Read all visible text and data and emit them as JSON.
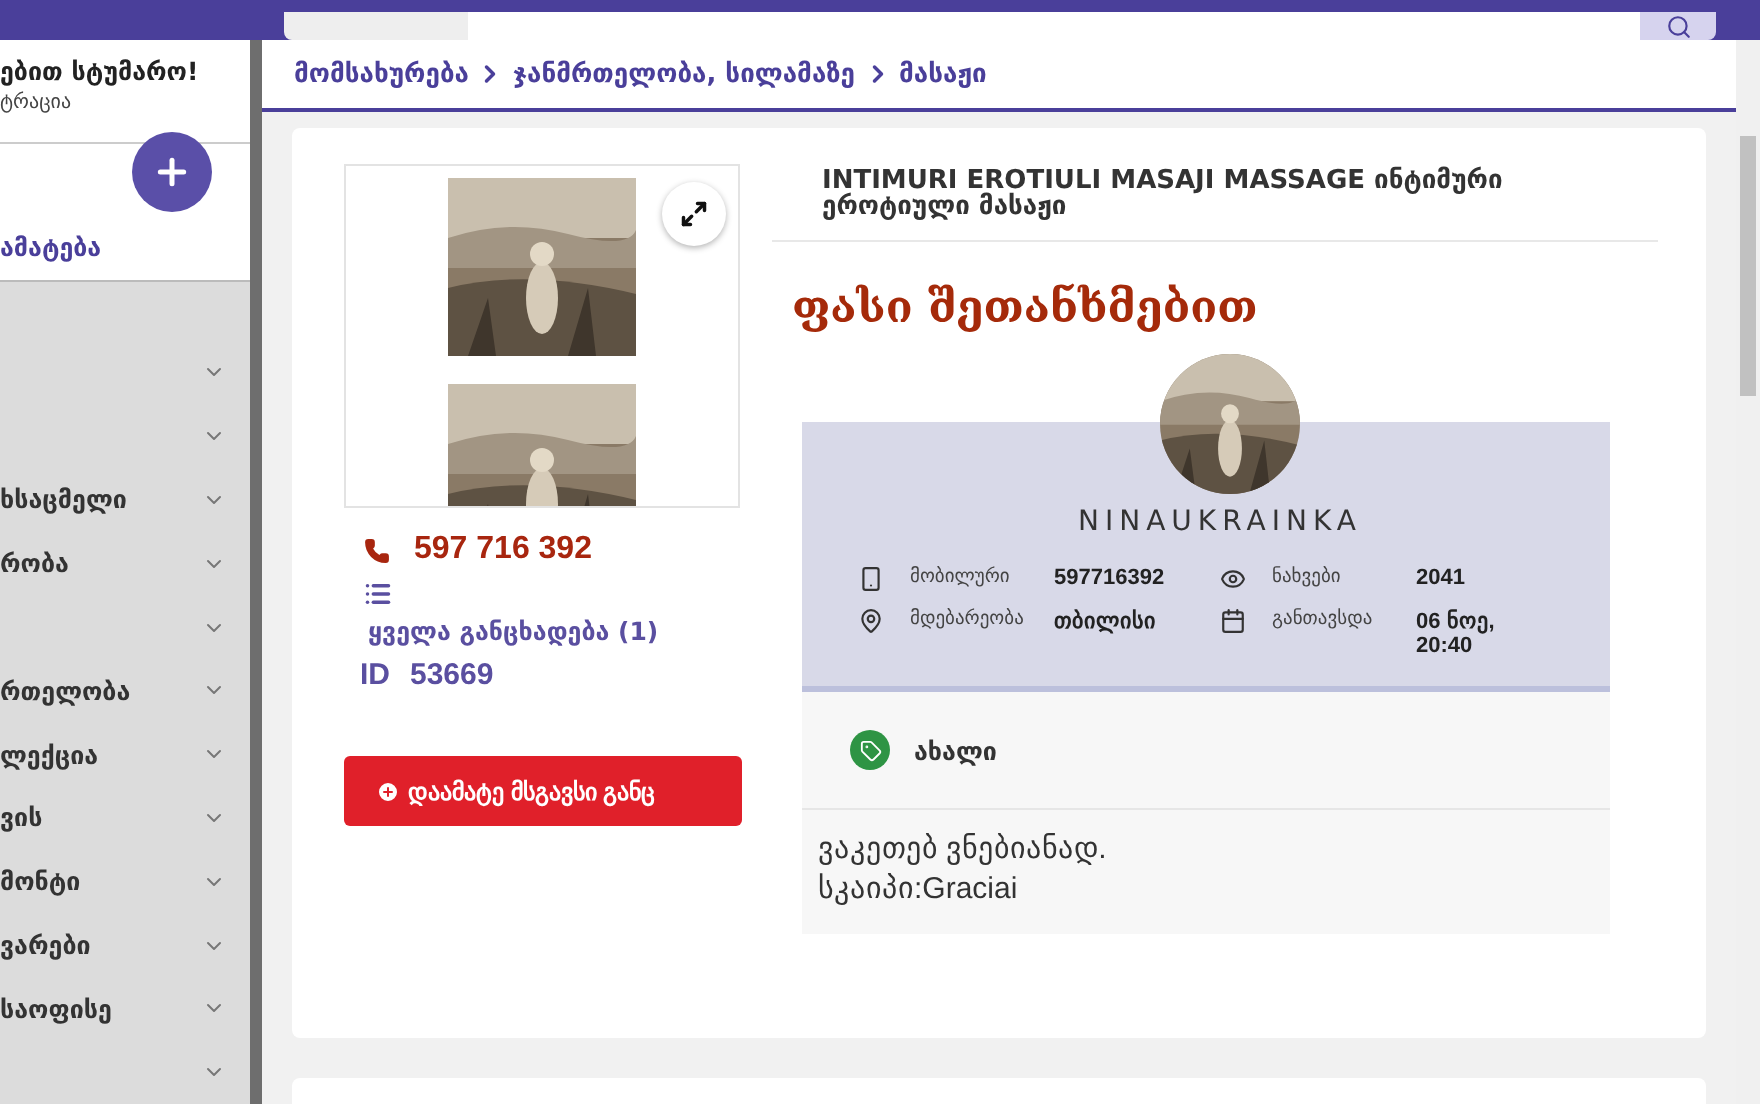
{
  "sidebar": {
    "greeting": "ებით სტუმარო!",
    "subtitle": "ტრაცია",
    "add_label": "ამატება",
    "categories": [
      {
        "kind": "hidden"
      },
      {
        "kind": "hidden"
      },
      {
        "kind": "text",
        "label": "ხსაცმელი"
      },
      {
        "kind": "text",
        "label": "რობა"
      },
      {
        "kind": "hidden"
      },
      {
        "kind": "text",
        "label": "რთელობა"
      },
      {
        "kind": "text",
        "label": "ლექცია"
      },
      {
        "kind": "text",
        "label": "ვის"
      },
      {
        "kind": "text",
        "label": "მონტი"
      },
      {
        "kind": "text",
        "label": "ვარები"
      },
      {
        "kind": "text",
        "label": "საოფისე"
      },
      {
        "kind": "hidden"
      }
    ]
  },
  "breadcrumb": [
    "მომსახურება",
    "ჯანმრთელობა, სილამაზე",
    "მასაჟი"
  ],
  "listing": {
    "title": "INTIMURI EROTIULI MASAJI MASSAGE ინტიმური ეროტიული მასაჟი",
    "price": "ფასი შეთანხმებით",
    "gallery": [
      {
        "kind": "picture"
      },
      {
        "kind": "picture"
      }
    ],
    "phone": "597 716 392",
    "all_ads": "ყველა განცხადება (1)",
    "id_label": "ID",
    "id": "53669",
    "similar_button": "დაამატე მსგავსი განც",
    "seller": {
      "username": "NINAUKRAINKA",
      "details": [
        {
          "kind": "mobile",
          "label": "მობილური",
          "value": "597716392"
        },
        {
          "kind": "views",
          "label": "ნახვები",
          "value": "2041"
        },
        {
          "kind": "location",
          "label": "მდებარეობა",
          "value": "თბილისი"
        },
        {
          "kind": "date",
          "label": "განთავსდა",
          "value": "06 ნოე, 20:40"
        }
      ]
    },
    "tag": "ახალი",
    "description": [
      "ვაკეთებ ვნებიანად.",
      "სკაიპი:Graciai"
    ]
  }
}
